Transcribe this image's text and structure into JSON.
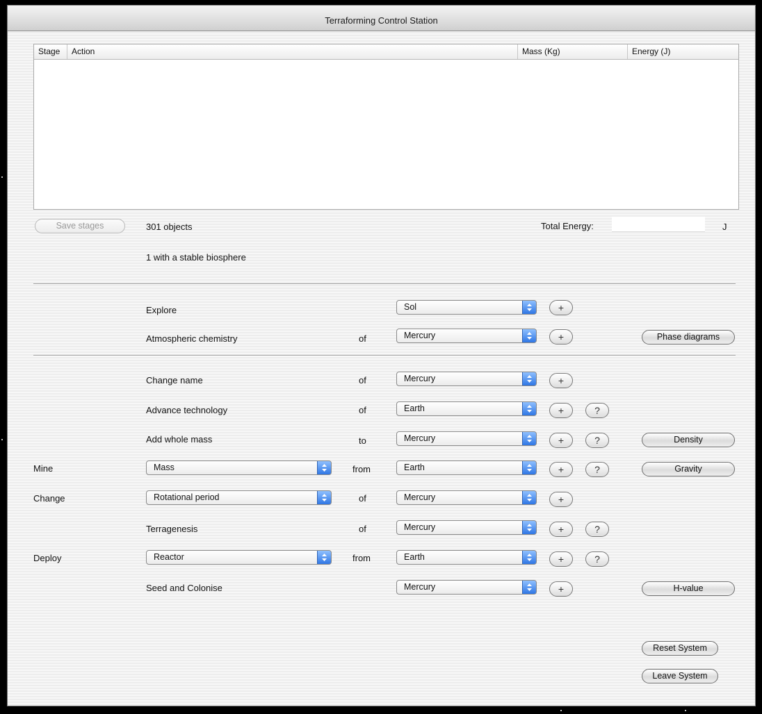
{
  "window": {
    "title": "Terraforming Control Station"
  },
  "table": {
    "columns": [
      "Stage",
      "Action",
      "Mass (Kg)",
      "Energy (J)"
    ]
  },
  "summary": {
    "save_label": "Save stages",
    "objects": "301 objects",
    "biosphere": "1 with a stable biosphere",
    "total_energy_label": "Total Energy:",
    "total_energy_value": "",
    "energy_unit": "J"
  },
  "rows": {
    "explore": {
      "label": "Explore",
      "target": "Sol"
    },
    "atmos": {
      "label": "Atmospheric chemistry",
      "prep": "of",
      "target": "Mercury",
      "side_button": "Phase diagrams"
    },
    "change_name": {
      "label": "Change name",
      "prep": "of",
      "target": "Mercury"
    },
    "advance_tech": {
      "label": "Advance technology",
      "prep": "of",
      "target": "Earth"
    },
    "add_mass": {
      "label": "Add whole mass",
      "prep": "to",
      "target": "Mercury",
      "side_button": "Density"
    },
    "mine": {
      "label": "Mine",
      "option": "Mass",
      "prep": "from",
      "target": "Earth",
      "side_button": "Gravity"
    },
    "change": {
      "label": "Change",
      "option": "Rotational period",
      "prep": "of",
      "target": "Mercury"
    },
    "terragenesis": {
      "label": "Terragenesis",
      "prep": "of",
      "target": "Mercury"
    },
    "deploy": {
      "label": "Deploy",
      "option": "Reactor",
      "prep": "from",
      "target": "Earth"
    },
    "seed": {
      "label": "Seed and Colonise",
      "target": "Mercury",
      "side_button": "H-value"
    }
  },
  "glyphs": {
    "plus": "+",
    "help": "?"
  },
  "buttons": {
    "reset": "Reset System",
    "leave": "Leave System"
  },
  "colors": {
    "accent": "#3b7fe6"
  }
}
